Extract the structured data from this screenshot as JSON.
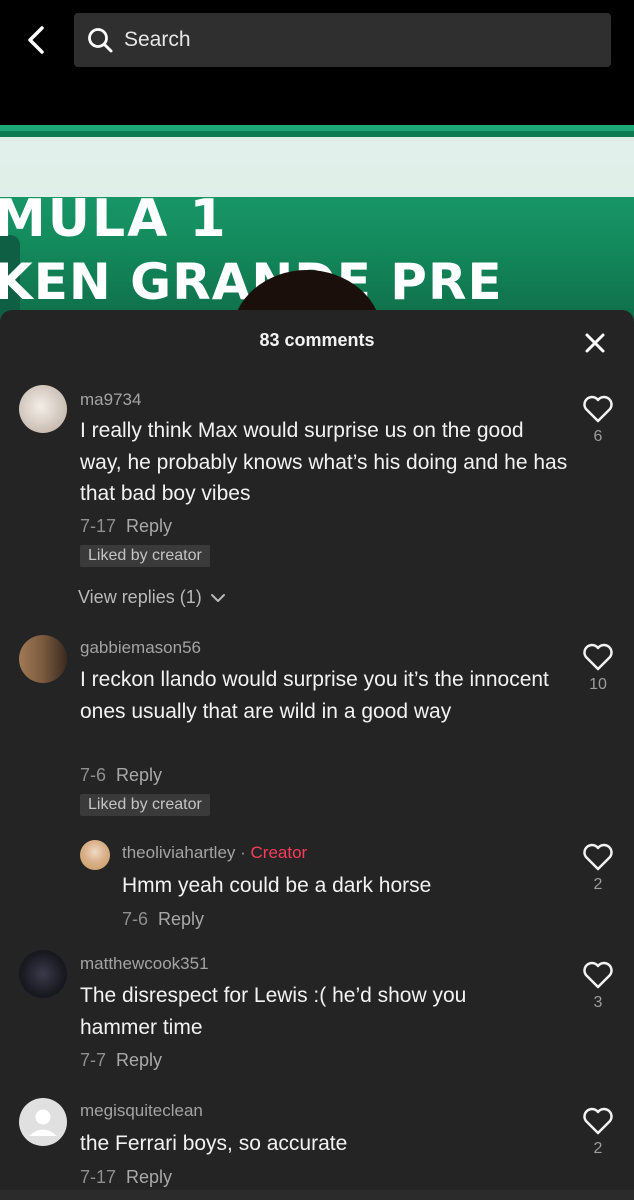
{
  "search": {
    "placeholder": "Search"
  },
  "video": {
    "line1": "MULA 1",
    "line2": "KEN GRANDE PRE"
  },
  "sheet": {
    "title": "83 comments"
  },
  "comments": [
    {
      "username": "ma9734",
      "text": "I really think Max would surprise us on the good way, he probably knows what’s his doing and he has that bad boy vibes",
      "date": "7-17",
      "reply_label": "Reply",
      "liked_badge": "Liked by creator",
      "view_replies": "View replies (1)",
      "likes": "6"
    },
    {
      "username": "gabbiemason56",
      "text": "I reckon llando would surprise you it’s the innocent ones usually that are wild in a good way",
      "date": "7-6",
      "reply_label": "Reply",
      "liked_badge": "Liked by creator",
      "likes": "10",
      "reply": {
        "username": "theoliviahartley",
        "separator": " · ",
        "creator_label": "Creator",
        "text": "Hmm yeah could be a dark horse",
        "date": "7-6",
        "reply_label": "Reply",
        "likes": "2"
      }
    },
    {
      "username": "matthewcook351",
      "text": "The disrespect for Lewis :( he’d show you hammer time",
      "date": "7-7",
      "reply_label": "Reply",
      "likes": "3"
    },
    {
      "username": "megisquiteclean",
      "text": "the Ferrari boys, so accurate",
      "date": "7-17",
      "reply_label": "Reply",
      "likes": "2"
    }
  ],
  "colors": {
    "background": "#242424",
    "creator_accent": "#ff3b5c",
    "liked_badge_bg": "#3a3a3a"
  }
}
